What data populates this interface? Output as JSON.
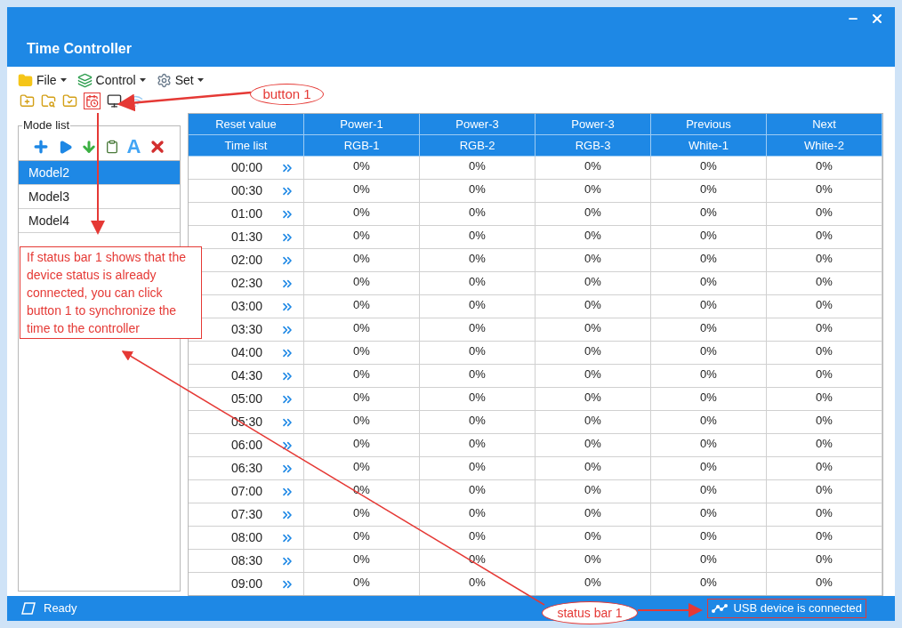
{
  "window": {
    "title": "Time Controller"
  },
  "menu": [
    {
      "label": "File",
      "kind": "folder"
    },
    {
      "label": "Control",
      "kind": "control"
    },
    {
      "label": "Set",
      "kind": "gear"
    }
  ],
  "mode_list": {
    "title": "Mode list",
    "rename_label": "A",
    "items": [
      {
        "label": "Model2",
        "selected": true
      },
      {
        "label": "Model3",
        "selected": false
      },
      {
        "label": "Model4",
        "selected": false
      }
    ]
  },
  "table": {
    "header_top": [
      "Reset value",
      "Power-1",
      "Power-3",
      "Power-3",
      "Previous",
      "Next"
    ],
    "header_bottom": [
      "Time list",
      "RGB-1",
      "RGB-2",
      "RGB-3",
      "White-1",
      "White-2"
    ],
    "rows": [
      {
        "time": "00:00",
        "values": [
          "0%",
          "0%",
          "0%",
          "0%",
          "0%"
        ]
      },
      {
        "time": "00:30",
        "values": [
          "0%",
          "0%",
          "0%",
          "0%",
          "0%"
        ]
      },
      {
        "time": "01:00",
        "values": [
          "0%",
          "0%",
          "0%",
          "0%",
          "0%"
        ]
      },
      {
        "time": "01:30",
        "values": [
          "0%",
          "0%",
          "0%",
          "0%",
          "0%"
        ]
      },
      {
        "time": "02:00",
        "values": [
          "0%",
          "0%",
          "0%",
          "0%",
          "0%"
        ]
      },
      {
        "time": "02:30",
        "values": [
          "0%",
          "0%",
          "0%",
          "0%",
          "0%"
        ]
      },
      {
        "time": "03:00",
        "values": [
          "0%",
          "0%",
          "0%",
          "0%",
          "0%"
        ]
      },
      {
        "time": "03:30",
        "values": [
          "0%",
          "0%",
          "0%",
          "0%",
          "0%"
        ]
      },
      {
        "time": "04:00",
        "values": [
          "0%",
          "0%",
          "0%",
          "0%",
          "0%"
        ]
      },
      {
        "time": "04:30",
        "values": [
          "0%",
          "0%",
          "0%",
          "0%",
          "0%"
        ]
      },
      {
        "time": "05:00",
        "values": [
          "0%",
          "0%",
          "0%",
          "0%",
          "0%"
        ]
      },
      {
        "time": "05:30",
        "values": [
          "0%",
          "0%",
          "0%",
          "0%",
          "0%"
        ]
      },
      {
        "time": "06:00",
        "values": [
          "0%",
          "0%",
          "0%",
          "0%",
          "0%"
        ]
      },
      {
        "time": "06:30",
        "values": [
          "0%",
          "0%",
          "0%",
          "0%",
          "0%"
        ]
      },
      {
        "time": "07:00",
        "values": [
          "0%",
          "0%",
          "0%",
          "0%",
          "0%"
        ]
      },
      {
        "time": "07:30",
        "values": [
          "0%",
          "0%",
          "0%",
          "0%",
          "0%"
        ]
      },
      {
        "time": "08:00",
        "values": [
          "0%",
          "0%",
          "0%",
          "0%",
          "0%"
        ]
      },
      {
        "time": "08:30",
        "values": [
          "0%",
          "0%",
          "0%",
          "0%",
          "0%"
        ]
      },
      {
        "time": "09:00",
        "values": [
          "0%",
          "0%",
          "0%",
          "0%",
          "0%"
        ]
      }
    ]
  },
  "status_bar": {
    "left": "Ready",
    "right": "USB device is connected"
  },
  "annotations": {
    "button_label": "button 1",
    "note": "If status bar 1 shows that the device status is already connected, you can click button 1 to synchronize the time to the controller",
    "status_label": "status bar 1"
  }
}
